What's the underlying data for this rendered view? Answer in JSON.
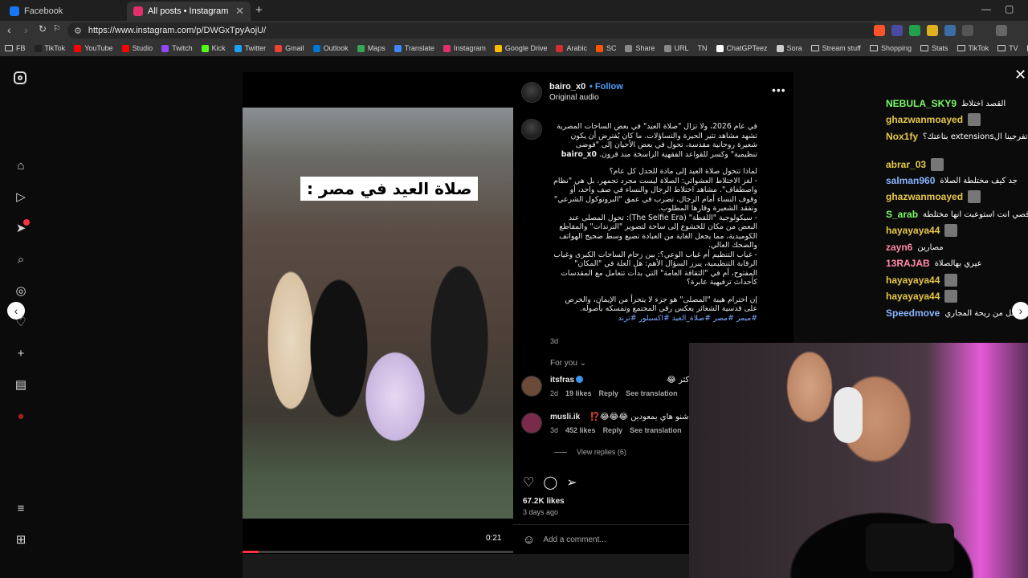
{
  "browser": {
    "tabs": [
      {
        "title": "Facebook",
        "color": "#1877f2"
      },
      {
        "title": "All posts • Instagram",
        "color": "#e1306c"
      }
    ],
    "url": "https://www.instagram.com/p/DWGxTpyAojU/",
    "bookmarks": [
      {
        "label": "FB",
        "type": "folder"
      },
      {
        "label": "TikTok",
        "color": "#222222"
      },
      {
        "label": "YouTube",
        "color": "#ff0000"
      },
      {
        "label": "Studio",
        "color": "#ff0000"
      },
      {
        "label": "Twitch",
        "color": "#9146ff"
      },
      {
        "label": "Kick",
        "color": "#53fc18"
      },
      {
        "label": "Twitter",
        "color": "#1da1f2"
      },
      {
        "label": "Gmail",
        "color": "#ea4335"
      },
      {
        "label": "Outlook",
        "color": "#0078d4"
      },
      {
        "label": "Maps",
        "color": "#34a853"
      },
      {
        "label": "Translate",
        "color": "#4285f4"
      },
      {
        "label": "Instagram",
        "color": "#e1306c"
      },
      {
        "label": "Google Drive",
        "color": "#fbbc04"
      },
      {
        "label": "Arabic",
        "color": "#d32f2f"
      },
      {
        "label": "SC",
        "color": "#ff5500"
      },
      {
        "label": "Share",
        "color": "#888888"
      },
      {
        "label": "URL",
        "color": "#888888"
      },
      {
        "label": "TN",
        "type": "text"
      },
      {
        "label": "ChatGPTeez",
        "color": "#ffffff"
      },
      {
        "label": "Sora",
        "color": "#cccccc"
      },
      {
        "label": "Stream stuff",
        "type": "folder"
      },
      {
        "label": "Shopping",
        "type": "folder"
      },
      {
        "label": "Stats",
        "type": "folder"
      },
      {
        "label": "TikTok",
        "type": "folder"
      },
      {
        "label": "TV",
        "type": "folder"
      },
      {
        "label": "Vids",
        "type": "folder"
      }
    ]
  },
  "post": {
    "username": "bairo_x0",
    "follow_label": "Follow",
    "audio": "Original audio",
    "video_overlay_text": "صلاة العيد في مصر :",
    "video_time": "0:21",
    "video_progress": 0.06,
    "caption_paragraphs": [
      "في عام 2026، ولا تزال \"صلاة العيد\" في بعض الساحات المصرية تشهد مشاهد تثير الحيرة والتساؤلات. ما كان يُفترض أن يكون شعيرة روحانية مقدسة، تحول في بعض الأحيان إلى \"فوضى تنظيمية\" وكسر للقواعد الفقهية الراسخة منذ قرون.",
      "لماذا تتحول صلاة العيد إلى مادة للجدل كل عام؟\n- لغز الاختلاط العشوائي: الصلاة ليست مجرد تجمهر، بل هي \"نظام واصطفاف\". مشاهد اختلاط الرجال والنساء في صف واحد، أو وقوف النساء أمام الرجال، تضرب في عمق \"البروتوكول الشرعي\" وتفقد الشعيرة وقارها المطلوب.\n- سيكولوجية \"اللقطة\" (The Selfie Era): تحول المصلى عند البعض من مكان للخشوع إلى ساحة لتصوير \"الترندات\" والمقاطع الكوميدية، مما يجعل الغاية من العبادة تضيع وسط ضجيج الهواتف والضحك العالي.\n- غياب التنظيم أم غياب الوعي؟: بين زحام الساحات الكبرى وغياب الرقابة التنظيمية، يبرز السؤال الأهم: هل العلة في \"المكان\" المفتوح، أم في \"الثقافة العامة\" التي بدأت تتعامل مع المقدسات كأحداث ترفيهية عابرة؟",
      "إن احترام هيبة \"المصلى\" هو جزء لا يتجزأ من الإيمان، والحرص على قدسية الشعائر يعكس رقي المجتمع وتمسكه بأصوله."
    ],
    "hashtags": "#ميمز #مصر #صلاة_العيد #اكسبلور #ترند",
    "caption_age": "3d",
    "for_you_label": "For you",
    "comments": [
      {
        "user": "itsfras",
        "verified": true,
        "text": "كل ما تركز تنصدم أكثر 😂",
        "age": "2d",
        "likes": "19 likes",
        "reply": "Reply",
        "translate": "See translation"
      },
      {
        "user": "musli.ik",
        "verified": false,
        "text": "ثة شنو هاي يمعودين 😂😂😂⁉️",
        "age": "3d",
        "likes": "452 likes",
        "reply": "Reply",
        "translate": "See translation"
      }
    ],
    "view_replies": "View replies (6)",
    "likes": "67.2K likes",
    "posted": "3 days ago",
    "comment_placeholder": "Add a comment..."
  },
  "chat": [
    {
      "user": "NEBULA_SKY9",
      "color": "#7cfc6a",
      "msg": "القصد اختلاط"
    },
    {
      "user": "ghazwanmoayed",
      "color": "#e8c84a",
      "msg": ""
    },
    {
      "user": "Nox1fy",
      "color": "#e8c84a",
      "msg": "ممكن تفرجينا الextensions بتاعتك؟"
    },
    {
      "user": "abrar_03",
      "color": "#e8c84a",
      "msg": ""
    },
    {
      "user": "salman960",
      "color": "#8ab4ff",
      "msg": "جد كيف مختلطة الصلاة"
    },
    {
      "user": "ghazwanmoayed",
      "color": "#e8c84a",
      "msg": ""
    },
    {
      "user": "S_arab",
      "color": "#7cfc6a",
      "msg": "قصي انت استوعبت انها مختلطة"
    },
    {
      "user": "hayayaya44",
      "color": "#e8c84a",
      "msg": ""
    },
    {
      "user": "zayn6",
      "color": "#ff8aa8",
      "msg": "مصارين"
    },
    {
      "user": "13RAJAB",
      "color": "#ff8aa8",
      "msg": "عيري بهالصلاة"
    },
    {
      "user": "hayayaya44",
      "color": "#e8c84a",
      "msg": ""
    },
    {
      "user": "hayayaya44",
      "color": "#e8c84a",
      "msg": ""
    },
    {
      "user": "Speedmove",
      "color": "#8ab4ff",
      "msg": "روايح بساحة اجمل من ريحة المجاري"
    }
  ]
}
